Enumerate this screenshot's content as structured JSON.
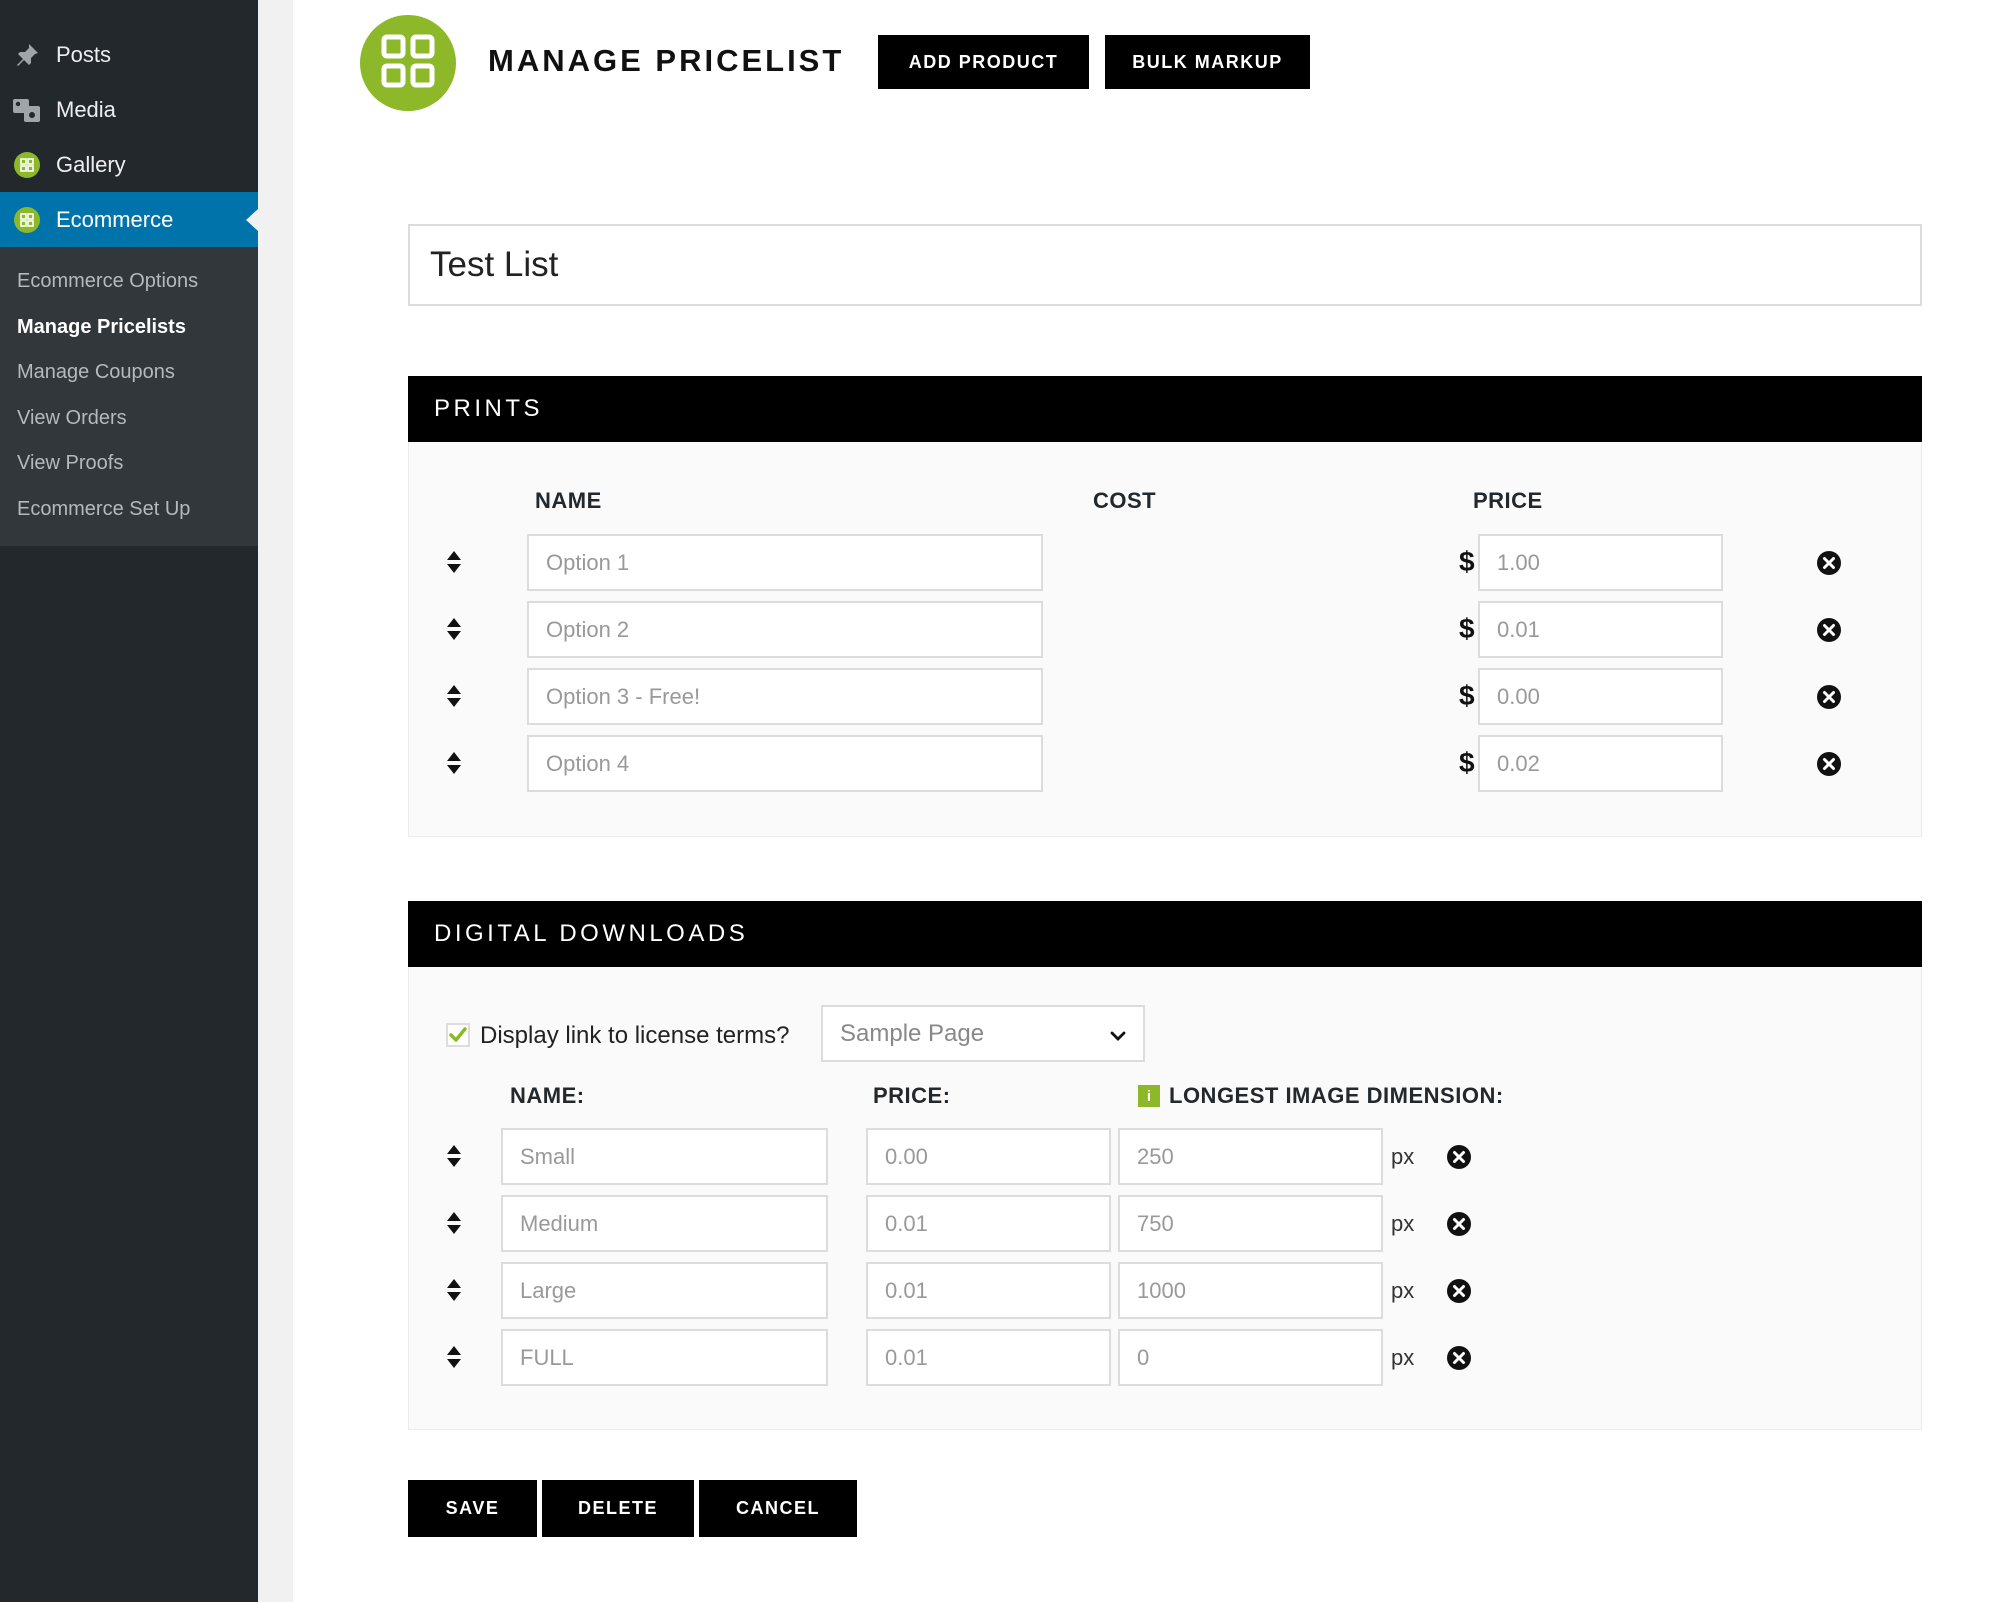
{
  "sidebar": {
    "menu": [
      {
        "label": "Posts",
        "icon": "pin-icon"
      },
      {
        "label": "Media",
        "icon": "media-icon"
      },
      {
        "label": "Gallery",
        "icon": "gallery-icon"
      },
      {
        "label": "Ecommerce",
        "icon": "ecommerce-icon",
        "active": true
      }
    ],
    "submenu": [
      {
        "label": "Ecommerce Options"
      },
      {
        "label": "Manage Pricelists",
        "current": true
      },
      {
        "label": "Manage Coupons"
      },
      {
        "label": "View Orders"
      },
      {
        "label": "View Proofs"
      },
      {
        "label": "Ecommerce Set Up"
      }
    ]
  },
  "header": {
    "title": "MANAGE PRICELIST",
    "add_product_label": "ADD PRODUCT",
    "bulk_markup_label": "BULK MARKUP"
  },
  "pricelist_name": "Test List",
  "prints": {
    "title": "PRINTS",
    "col_name": "NAME",
    "col_cost": "COST",
    "col_price": "PRICE",
    "currency": "$",
    "rows": [
      {
        "name": "Option 1",
        "price": "1.00"
      },
      {
        "name": "Option 2",
        "price": "0.01"
      },
      {
        "name": "Option 3 - Free!",
        "price": "0.00"
      },
      {
        "name": "Option 4",
        "price": "0.02"
      }
    ]
  },
  "downloads": {
    "title": "DIGITAL DOWNLOADS",
    "license_label": "Display link to license terms?",
    "license_checked": true,
    "license_page": "Sample Page",
    "col_name": "NAME:",
    "col_price": "PRICE:",
    "col_dimension": "LONGEST IMAGE DIMENSION:",
    "info_glyph": "i",
    "unit": "px",
    "rows": [
      {
        "name": "Small",
        "price": "0.00",
        "dimension": "250"
      },
      {
        "name": "Medium",
        "price": "0.01",
        "dimension": "750"
      },
      {
        "name": "Large",
        "price": "0.01",
        "dimension": "1000"
      },
      {
        "name": "FULL",
        "price": "0.01",
        "dimension": "0"
      }
    ]
  },
  "footer": {
    "save_label": "SAVE",
    "delete_label": "DELETE",
    "cancel_label": "CANCEL"
  },
  "colors": {
    "accent_green": "#8cb82a",
    "sidebar_bg": "#23282d",
    "active_blue": "#0073aa"
  }
}
